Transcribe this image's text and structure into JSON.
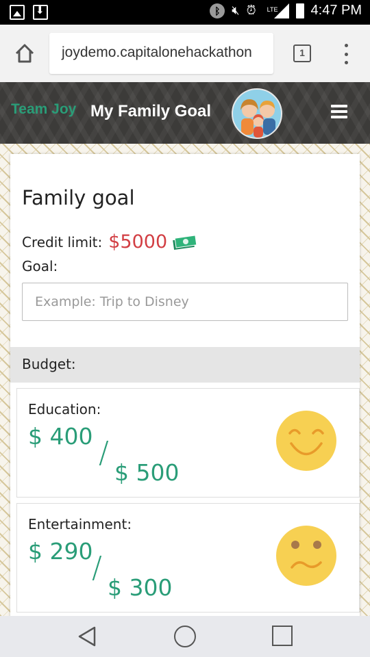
{
  "status_bar": {
    "time": "4:47 PM",
    "network_label": "LTE",
    "icons": [
      "image-notification-icon",
      "download-notification-icon",
      "bluetooth-icon",
      "mute-icon",
      "alarm-icon",
      "signal-icon",
      "battery-icon"
    ]
  },
  "browser": {
    "url": "joydemo.capitalonehackathon",
    "tab_count": "1",
    "icons": [
      "home-icon",
      "tab-switcher-icon",
      "overflow-menu-icon"
    ]
  },
  "header": {
    "brand": "Team Joy",
    "title": "My Family Goal",
    "icons": [
      "family-avatar-icon",
      "hamburger-menu-icon"
    ]
  },
  "card": {
    "title": "Family goal",
    "credit_label": "Credit limit:",
    "credit_value": "$5000",
    "goal_label": "Goal:",
    "goal_placeholder": "Example: Trip to Disney",
    "goal_value": "",
    "budget_label": "Budget:",
    "budget_items": [
      {
        "label": "Education:",
        "spent": "$ 400",
        "slash": "/",
        "limit": "$ 500",
        "mood": "happy-face-icon"
      },
      {
        "label": "Entertainment:",
        "spent": "$ 290",
        "slash": "/",
        "limit": "$ 300",
        "mood": "worried-face-icon"
      }
    ]
  },
  "nav": {
    "icons": [
      "back-icon",
      "home-circle-icon",
      "recent-apps-icon"
    ]
  },
  "colors": {
    "brand_green": "#2a9d78",
    "credit_red": "#d23e43",
    "header_dark": "#3c3b39",
    "face_yellow": "#f7d052",
    "budget_bar": "#e5e5e5"
  }
}
